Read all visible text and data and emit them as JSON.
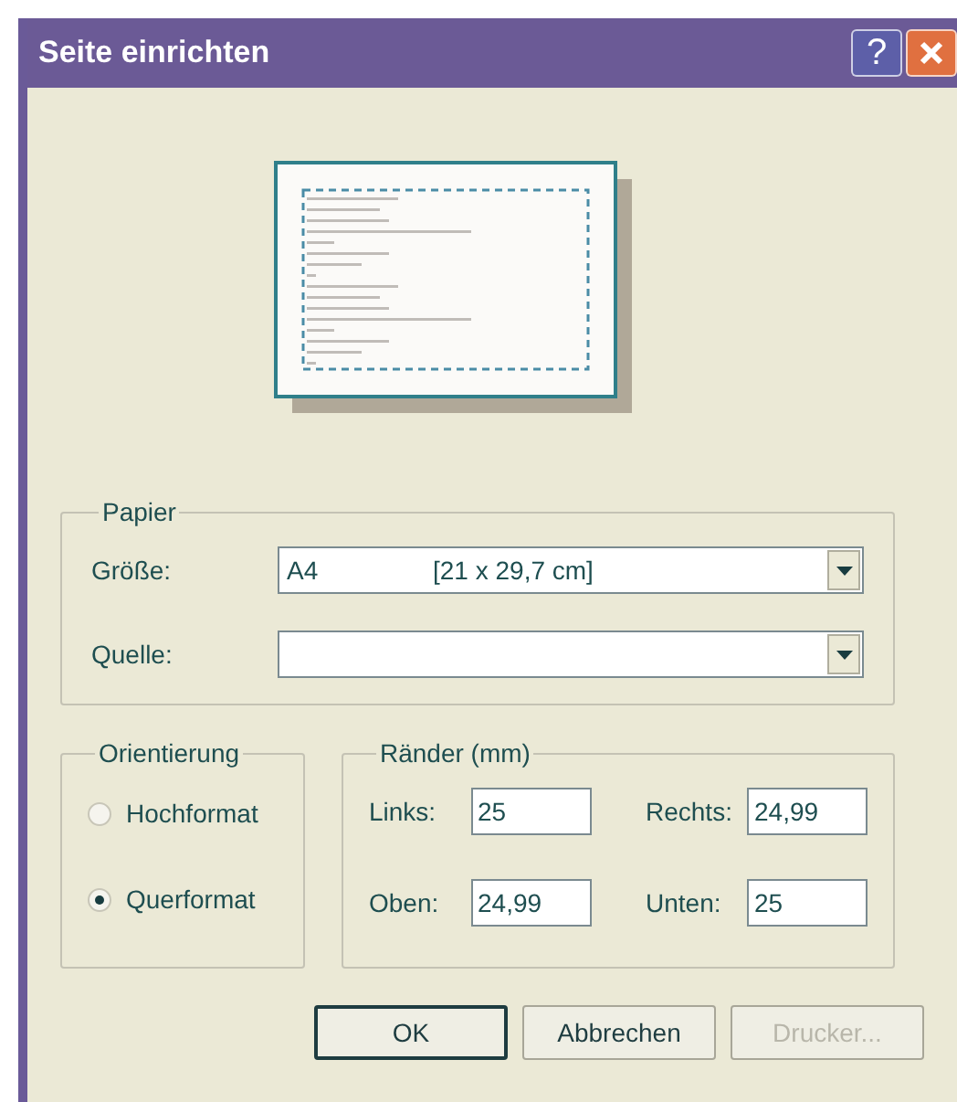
{
  "window": {
    "title": "Seite einrichten",
    "help_button": "?"
  },
  "paper": {
    "title": "Papier",
    "fields": [
      {
        "label": "Größe:",
        "value": "A4",
        "detail": "[21 x 29,7 cm]"
      },
      {
        "label": "Quelle:"
      }
    ]
  },
  "orientation": {
    "title": "Orientierung",
    "options": [
      {
        "label": "Hochformat",
        "selected": false
      },
      {
        "label": "Querformat",
        "selected": true
      }
    ]
  },
  "margins": {
    "title": "Ränder (mm)",
    "fields": [
      {
        "label": "Links:",
        "value": "25"
      },
      {
        "label": "Rechts:",
        "value": "24,99"
      },
      {
        "label": "Oben:",
        "value": "24,99"
      },
      {
        "label": "Unten:",
        "value": "25"
      }
    ]
  },
  "buttons": [
    {
      "label": "OK",
      "default": true,
      "disabled": false
    },
    {
      "label": "Abbrechen",
      "default": false,
      "disabled": false
    },
    {
      "label": "Drucker...",
      "default": false,
      "disabled": true
    }
  ]
}
